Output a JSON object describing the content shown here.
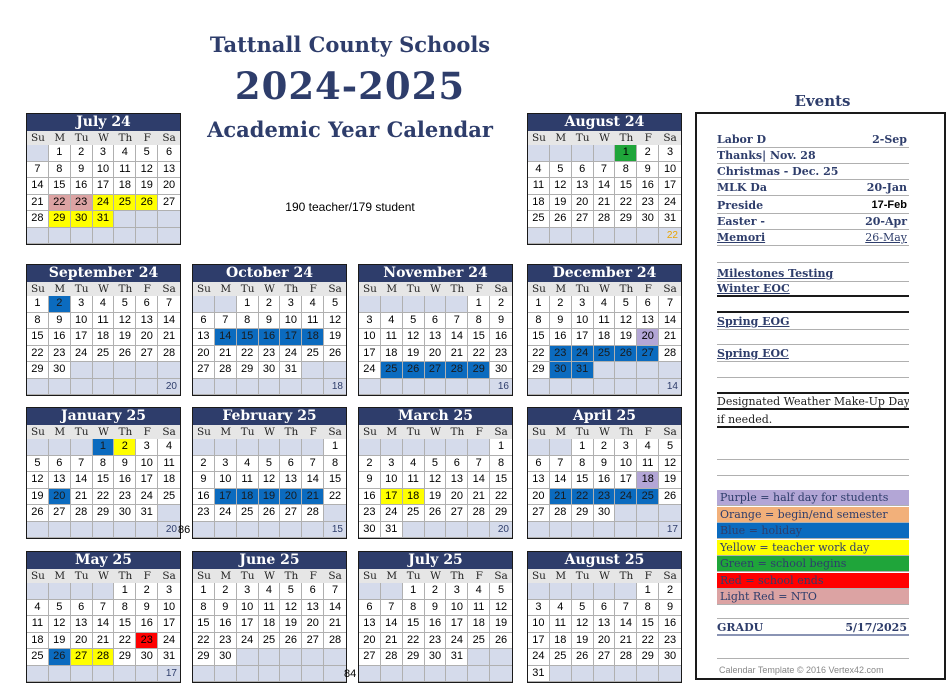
{
  "header": {
    "line1": "Tattnall County Schools",
    "line2": "2024-2025",
    "line3": "Academic Year Calendar",
    "subtitle": "190 teacher/179 student"
  },
  "dow": [
    "Su",
    "M",
    "Tu",
    "W",
    "Th",
    "F",
    "Sa"
  ],
  "months": [
    {
      "name": "July 24",
      "start": 1,
      "days": 31,
      "count": "",
      "colors": {
        "22": "lightred",
        "23": "lightred",
        "24": "yellow",
        "25": "yellow",
        "26": "yellow",
        "29": "yellow",
        "30": "yellow",
        "31": "yellow"
      }
    },
    {
      "name": "August 24",
      "start": 4,
      "days": 31,
      "count": "22",
      "countGold": true,
      "colors": {
        "1": "green"
      }
    },
    {
      "name": "September 24",
      "start": 0,
      "days": 30,
      "count": "20",
      "colors": {
        "2": "blue"
      }
    },
    {
      "name": "October 24",
      "start": 2,
      "days": 31,
      "count": "18",
      "colors": {
        "14": "blue",
        "15": "blue",
        "16": "blue",
        "17": "blue",
        "18": "blue"
      }
    },
    {
      "name": "November 24",
      "start": 5,
      "days": 30,
      "count": "16",
      "colors": {
        "25": "blue",
        "26": "blue",
        "27": "blue",
        "28": "blue",
        "29": "blue"
      }
    },
    {
      "name": "December 24",
      "start": 0,
      "days": 31,
      "count": "14",
      "colors": {
        "20": "purple",
        "23": "blue",
        "24": "blue",
        "25": "blue",
        "26": "blue",
        "27": "blue",
        "30": "blue",
        "31": "blue"
      }
    },
    {
      "name": "January 25",
      "start": 3,
      "days": 31,
      "count": "20",
      "colors": {
        "1": "blue",
        "2": "yellow",
        "20": "blue"
      }
    },
    {
      "name": "February 25",
      "start": 6,
      "days": 28,
      "count": "15",
      "colors": {
        "17": "blue",
        "18": "blue",
        "19": "blue",
        "20": "blue",
        "21": "blue"
      }
    },
    {
      "name": "March 25",
      "start": 6,
      "days": 31,
      "count": "20",
      "colors": {
        "17": "yellow",
        "18": "yellow"
      }
    },
    {
      "name": "April 25",
      "start": 2,
      "days": 30,
      "count": "17",
      "colors": {
        "18": "purple",
        "21": "blue",
        "22": "blue",
        "23": "blue",
        "24": "blue",
        "25": "blue"
      }
    },
    {
      "name": "May 25",
      "start": 4,
      "days": 31,
      "count": "17",
      "colors": {
        "23": "red",
        "26": "blue",
        "27": "yellow",
        "28": "yellow"
      }
    },
    {
      "name": "June 25",
      "start": 0,
      "days": 30,
      "count": "",
      "colors": {}
    },
    {
      "name": "July 25",
      "start": 2,
      "days": 31,
      "count": "",
      "colors": {}
    },
    {
      "name": "August 25",
      "start": 5,
      "days": 31,
      "count": "",
      "colors": {}
    }
  ],
  "semester_totals": {
    "first": "86",
    "second": "84"
  },
  "events": {
    "title": "Events",
    "items": [
      {
        "label": "Labor D",
        "date": "2-Sep"
      },
      {
        "label": "Thanks| Nov. 28",
        "date": ""
      },
      {
        "label": "Christmas - Dec. 25",
        "date": ""
      },
      {
        "label": "MLK Da",
        "date": "20-Jan"
      },
      {
        "label": "Preside",
        "date": "17-Feb"
      },
      {
        "label": "Easter -",
        "date": "20-Apr"
      },
      {
        "label": "Memori",
        "date": "26-May"
      }
    ],
    "testing": [
      "Milestones Testing",
      "Winter EOC",
      "Spring EOG",
      "Spring EOC"
    ],
    "weather_note": [
      "Designated Weather Make-Up Days",
      "if needed."
    ],
    "legend": [
      {
        "label": "Purple = half day for students",
        "color": "#b3a6d6"
      },
      {
        "label": "Orange = begin/end semester",
        "color": "#f2b07a"
      },
      {
        "label": "Blue = holiday",
        "color": "#0b6bbf"
      },
      {
        "label": "Yellow = teacher work day",
        "color": "#ffff00"
      },
      {
        "label": "Green = school begins",
        "color": "#1fa53a"
      },
      {
        "label": "Red = school ends",
        "color": "#ff0000"
      },
      {
        "label": "Light Red = NTO",
        "color": "#dca3a3"
      }
    ],
    "graduation": {
      "label": "GRADU",
      "date": "5/17/2025"
    },
    "credit": "Calendar Template © 2016 Vertex42.com"
  }
}
